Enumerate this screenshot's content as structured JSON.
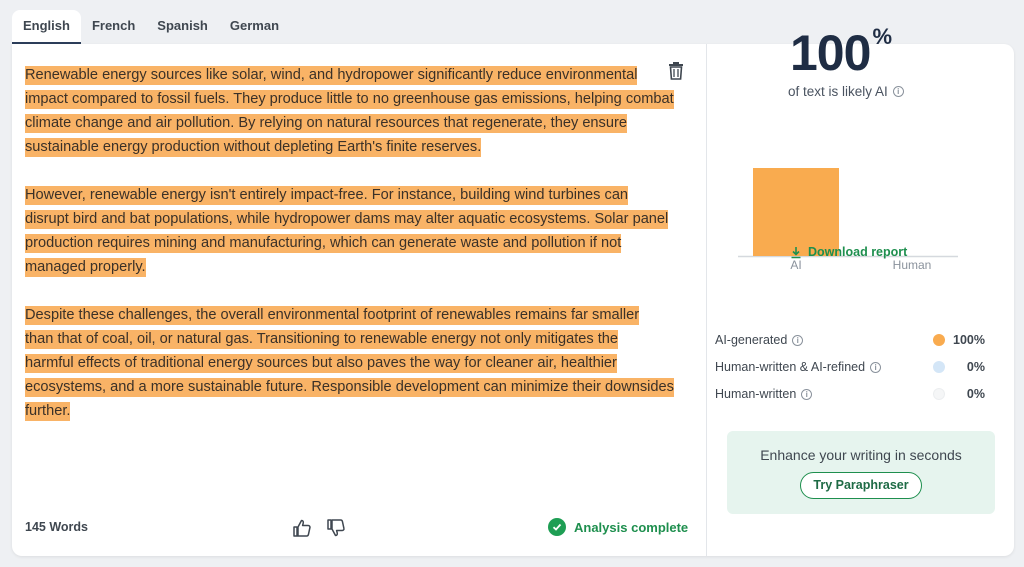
{
  "tabs": [
    {
      "label": "English",
      "active": true
    },
    {
      "label": "French",
      "active": false
    },
    {
      "label": "Spanish",
      "active": false
    },
    {
      "label": "German",
      "active": false
    }
  ],
  "editor": {
    "lines": [
      [
        "Renewable energy sources like solar, wind, and hydropower significantly reduce environmental",
        "impact compared to fossil fuels. They produce little to no greenhouse gas emissions, helping combat",
        "climate change and air pollution. By relying on natural resources that regenerate, they ensure",
        "sustainable energy production without depleting Earth's finite reserves."
      ],
      [
        "However, renewable energy isn't entirely impact-free. For instance, building wind turbines can",
        "disrupt bird and bat populations, while hydropower dams may alter aquatic ecosystems. Solar panel",
        "production requires mining and manufacturing, which can generate waste and pollution if not",
        "managed properly."
      ],
      [
        "Despite these challenges, the overall environmental footprint of renewables remains far smaller",
        "than that of coal, oil, or natural gas. Transitioning to renewable energy not only mitigates the",
        "harmful effects of traditional energy sources but also paves the way for cleaner air, healthier",
        "ecosystems, and a more sustainable future. Responsible development can minimize their downsides",
        "further."
      ]
    ],
    "highlight_color": "#f9b366"
  },
  "footer": {
    "word_count": "145 Words",
    "status": "Analysis complete"
  },
  "result": {
    "percent": "100",
    "percent_sign": "%",
    "label": "of text is likely AI",
    "download_label": "Download report"
  },
  "chart_data": {
    "type": "bar",
    "categories": [
      "AI",
      "Human"
    ],
    "values": [
      100,
      0
    ],
    "colors": [
      "#f9ab4f",
      "#c9def0"
    ],
    "ylim": [
      0,
      100
    ]
  },
  "legend": [
    {
      "label": "AI-generated",
      "value": "100%",
      "color": "#f9ab4f"
    },
    {
      "label": "Human-written & AI-refined",
      "value": "0%",
      "color": "#d4e6f7"
    },
    {
      "label": "Human-written",
      "value": "0%",
      "color": "#f5f6f7"
    }
  ],
  "promo": {
    "text": "Enhance your writing in seconds",
    "button": "Try Paraphraser"
  },
  "colors": {
    "accent_green": "#1e8f4e",
    "title_navy": "#1f2d44"
  }
}
